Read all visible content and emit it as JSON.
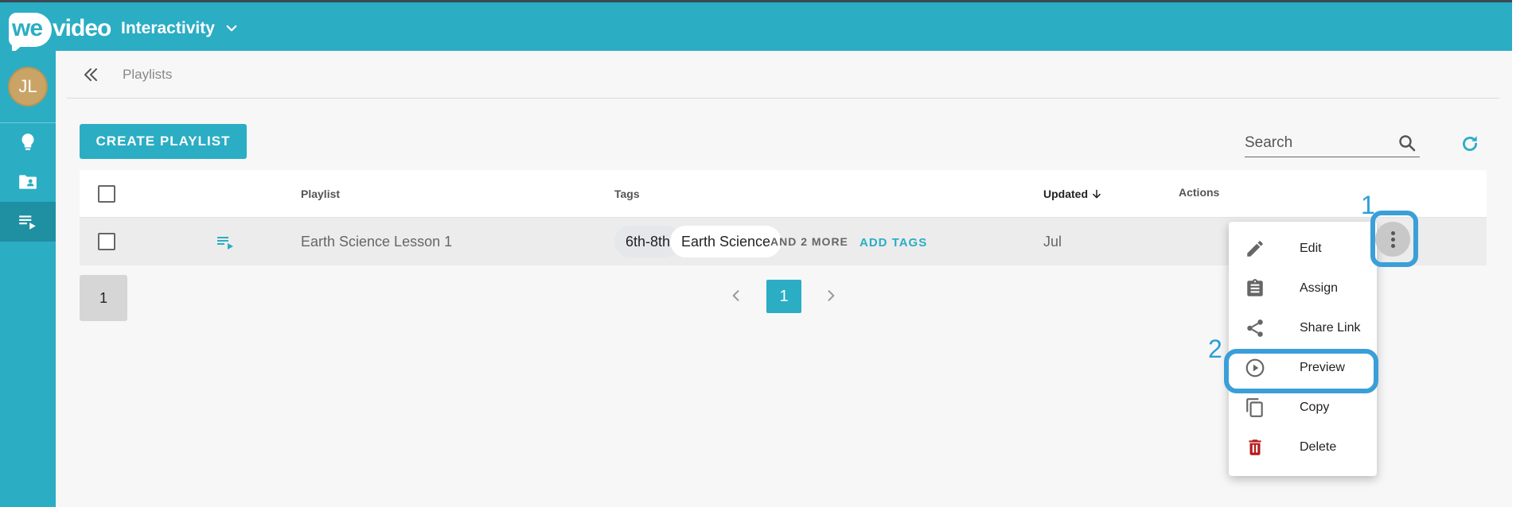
{
  "header": {
    "logo_we": "we",
    "logo_video": "video",
    "app_name": "Interactivity"
  },
  "sidebar": {
    "avatar_initials": "JL",
    "items": [
      {
        "icon": "lightbulb-icon"
      },
      {
        "icon": "shared-folder-icon"
      },
      {
        "icon": "playlist-icon",
        "active": true
      }
    ]
  },
  "breadcrumb": {
    "current": "Playlists"
  },
  "toolbar": {
    "create_label": "CREATE PLAYLIST",
    "search_placeholder": "Search"
  },
  "table": {
    "headers": {
      "playlist": "Playlist",
      "tags": "Tags",
      "updated": "Updated",
      "actions": "Actions"
    },
    "rows": [
      {
        "name": "Earth Science Lesson 1",
        "tags": [
          "6th-8th",
          "Earth Science"
        ],
        "more_tags": "AND 2 MORE",
        "add_tags": "ADD TAGS",
        "updated": "Jul"
      }
    ]
  },
  "pagination": {
    "rows_per_page": "1",
    "current_page": "1"
  },
  "annotations": {
    "step1": "1",
    "step2": "2"
  },
  "actions_menu": {
    "items": [
      {
        "label": "Edit",
        "icon": "pencil-icon"
      },
      {
        "label": "Assign",
        "icon": "clipboard-icon"
      },
      {
        "label": "Share Link",
        "icon": "share-icon"
      },
      {
        "label": "Preview",
        "icon": "play-circle-icon"
      },
      {
        "label": "Copy",
        "icon": "copy-icon"
      },
      {
        "label": "Delete",
        "icon": "trash-icon"
      }
    ]
  },
  "colors": {
    "brand": "#2badc4",
    "annotation": "#3a9fd8",
    "delete": "#b71c1c"
  }
}
